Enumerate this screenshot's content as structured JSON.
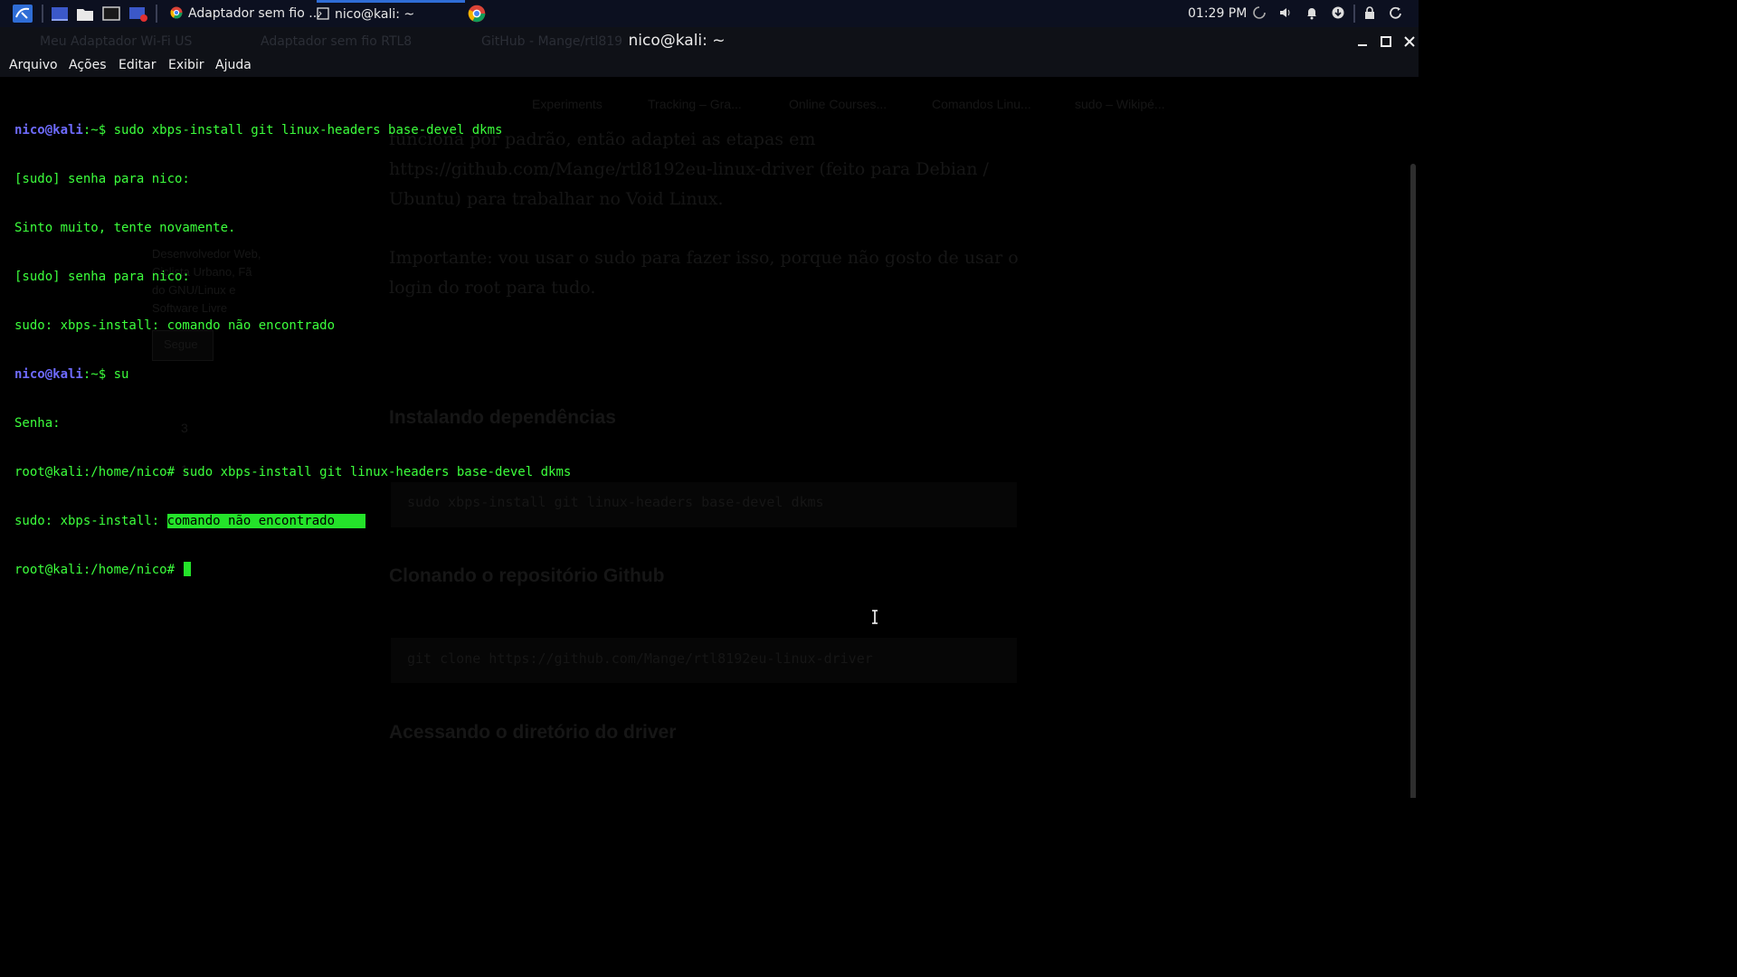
{
  "taskbar": {
    "tasks": [
      {
        "label": "Adaptador sem fio ..."
      },
      {
        "label": "nico@kali: ~"
      }
    ],
    "clock": "01:29 PM",
    "icons": [
      "kali-menu-icon",
      "desktop-icon",
      "file-manager-icon",
      "terminal-icon",
      "screenshot-icon",
      "chrome-icon",
      "spinner-icon",
      "volume-icon",
      "bell-icon",
      "download-icon",
      "lock-icon",
      "power-icon"
    ]
  },
  "window": {
    "title": "nico@kali: ~",
    "background_tabs": [
      {
        "label": "Meu Adaptador Wi-Fi US"
      },
      {
        "label": "Adaptador sem fio RTL8"
      },
      {
        "label": "GitHub - Mange/rtl819"
      }
    ],
    "controls": [
      "minimize-icon",
      "maximize-icon",
      "close-icon"
    ]
  },
  "menu": {
    "items": [
      {
        "label": "Arquivo"
      },
      {
        "label": "Ações"
      },
      {
        "label": "Editar"
      },
      {
        "label": "Exibir"
      },
      {
        "label": "Ajuda"
      }
    ]
  },
  "terminal": {
    "lines": [
      {
        "prompt_user": "nico@kali",
        "prompt_path": ":~$",
        "text": " sudo xbps-install git linux-headers base-devel dkms"
      },
      {
        "text": "[sudo] senha para nico:"
      },
      {
        "text": "Sinto muito, tente novamente."
      },
      {
        "text": "[sudo] senha para nico:"
      },
      {
        "text": "sudo: xbps-install: comando não encontrado"
      },
      {
        "prompt_user": "nico@kali",
        "prompt_path": ":~$",
        "text": " su"
      },
      {
        "text": "Senha:"
      },
      {
        "text": "root@kali:/home/nico# sudo xbps-install git linux-headers base-devel dkms"
      },
      {
        "text": "sudo: xbps-install: ",
        "highlight": "comando não encontrado    "
      },
      {
        "text": "root@kali:/home/nico# "
      }
    ],
    "colors": {
      "text": "#3cff3c",
      "prompt_user": "#6e6bff",
      "highlight_bg": "#24e32a",
      "background": "#000000"
    }
  },
  "background_page": {
    "bookmarks": [
      "Experiments",
      "Tracking – Gra...",
      "Online Courses...",
      "Comandos Linu...",
      "sudo – Wikipé..."
    ],
    "article_lines": [
      "funciona por padrão, então adaptei as etapas em",
      "https://github.com/Mange/rtl8192eu-linux-driver (feito para Debian /",
      "Ubuntu) para trabalhar no Void Linux.",
      "Importante: vou usar o sudo para fazer isso, porque não gosto de usar o",
      "login do root para tudo."
    ],
    "headings": [
      "Instalando dependências",
      "Clonando o repositório Github",
      "Acessando o diretório do driver"
    ],
    "code_1": "sudo xbps-install git linux-headers base-devel dkms",
    "code_2": "git clone https://github.com/Mange/rtl8192eu-linux-driver",
    "sidebar_lines": [
      "Desenvolvedor Web,",
      "Ciclista Urbano, Fã",
      "do GNU/Linux e",
      "Software Livre"
    ],
    "follow_button": "Segue",
    "counts": [
      "3",
      "1"
    ]
  }
}
